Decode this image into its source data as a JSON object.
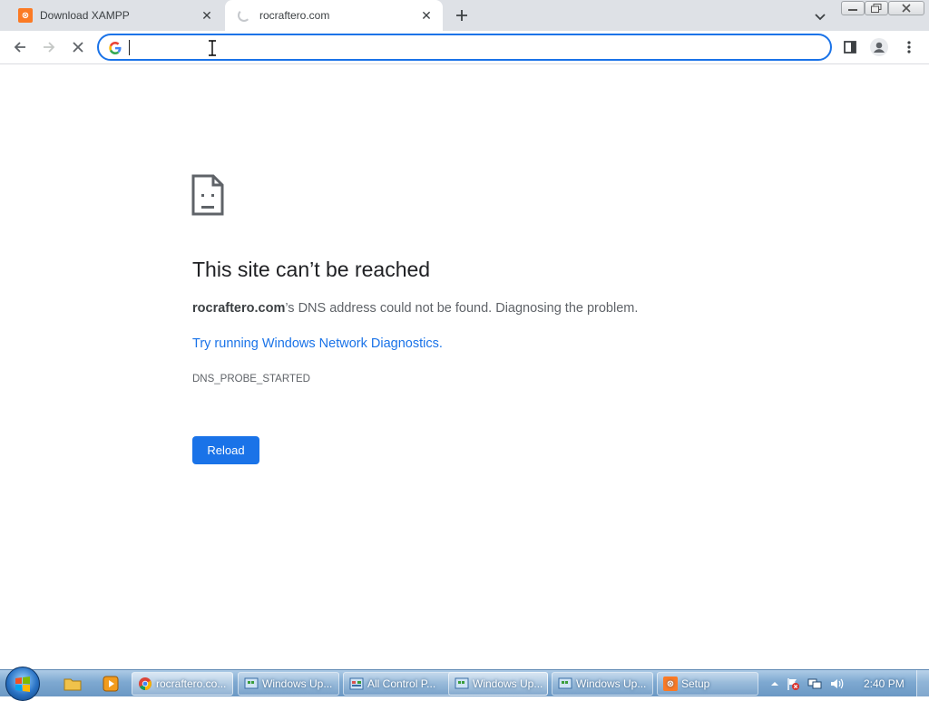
{
  "browser": {
    "tabs": [
      {
        "title": "Download XAMPP",
        "icon": "xampp-icon",
        "active": false
      },
      {
        "title": "rocraftero.com",
        "icon": "loading-spinner-icon",
        "active": true
      }
    ],
    "toolbar": {
      "address_value": "",
      "search_engine_icon": "google-icon"
    }
  },
  "error_page": {
    "icon": "sad-page-icon",
    "title": "This site can’t be reached",
    "domain": "rocraftero.com",
    "description_suffix": "’s DNS address could not be found. Diagnosing the problem.",
    "diagnostics_link": "Try running Windows Network Diagnostics.",
    "error_code": "DNS_PROBE_STARTED",
    "reload_label": "Reload"
  },
  "taskbar": {
    "items": [
      {
        "label": "rocraftero.co...",
        "icon": "chrome-icon",
        "active": true
      },
      {
        "label": "Windows Up...",
        "icon": "windows-update-icon",
        "active": false
      },
      {
        "label": "All Control P...",
        "icon": "control-panel-icon",
        "active": false
      },
      {
        "label": "Windows Up...",
        "icon": "windows-update-icon",
        "active": false
      },
      {
        "label": "Windows Up...",
        "icon": "windows-update-icon",
        "active": false
      },
      {
        "label": "Setup",
        "icon": "xampp-icon",
        "active": false
      }
    ],
    "clock": "2:40 PM"
  },
  "colors": {
    "accent": "#1a73e8",
    "tabstrip": "#dee1e6",
    "title_text": "#202124",
    "body_text": "#5f6368"
  }
}
